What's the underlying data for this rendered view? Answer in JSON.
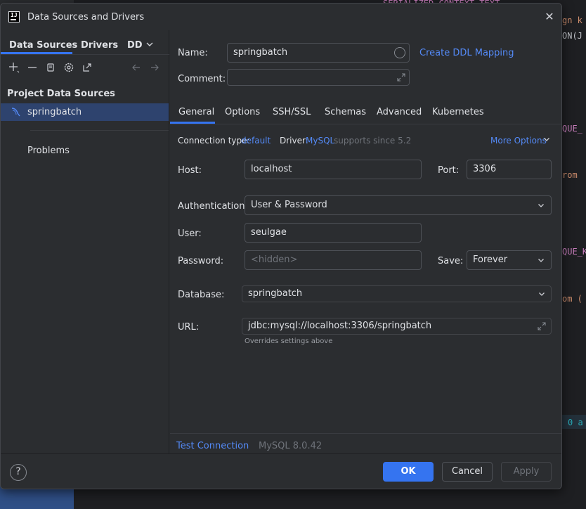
{
  "background_code": {
    "line1": "SERIALIZED_CONTEXT TEXT",
    "line2": "gn k",
    "line3": "ON(J",
    "line4": "QUE_",
    "line5": "rom",
    "line6": "QUE_K",
    "line7": "om (",
    "line8": "0 a"
  },
  "dialog": {
    "title": "Data Sources and Drivers",
    "close_glyph": "✕"
  },
  "left": {
    "tabs": [
      "Data Sources",
      "Drivers",
      "DDL"
    ],
    "section_title": "Project Data Sources",
    "tree_item": "springbatch",
    "problems": "Problems"
  },
  "form": {
    "name_label": "Name:",
    "name_value": "springbatch",
    "ddl_link": "Create DDL Mapping",
    "comment_label": "Comment:",
    "comment_value": "",
    "tabs": [
      "General",
      "Options",
      "SSH/SSL",
      "Schemas",
      "Advanced",
      "Kubernetes"
    ],
    "conn_type_label": "Connection type:",
    "conn_type_value": "default",
    "driver_label": "Driver:",
    "driver_value": "MySQL",
    "driver_note": "supports since 5.2",
    "more_options": "More Options",
    "host_label": "Host:",
    "host_value": "localhost",
    "port_label": "Port:",
    "port_value": "3306",
    "auth_label": "Authentication:",
    "auth_value": "User & Password",
    "user_label": "User:",
    "user_value": "seulgae",
    "password_label": "Password:",
    "password_placeholder": "<hidden>",
    "save_label": "Save:",
    "save_value": "Forever",
    "database_label": "Database:",
    "database_value": "springbatch",
    "url_label": "URL:",
    "url_value": "jdbc:mysql://localhost:3306/springbatch",
    "url_hint": "Overrides settings above",
    "test_connection": "Test Connection",
    "server_version": "MySQL 8.0.42"
  },
  "footer": {
    "help": "?",
    "ok": "OK",
    "cancel": "Cancel",
    "apply": "Apply"
  },
  "colors": {
    "accent": "#3574f0",
    "link": "#548af7",
    "selection": "#2e436e",
    "dialog_bg": "#2b2d30"
  }
}
